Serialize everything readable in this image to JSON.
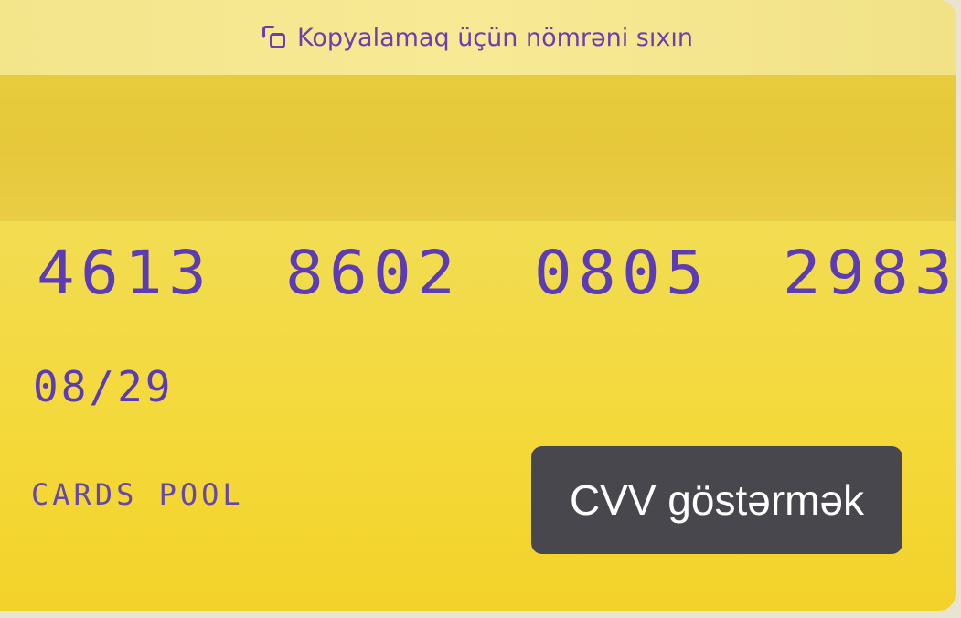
{
  "copy_hint": {
    "icon": "copy-icon",
    "text": "Kopyalamaq üçün nömrəni sıxın",
    "color": "#6b3fb0"
  },
  "card": {
    "number_groups": [
      "4613",
      "8602",
      "0805",
      "2983"
    ],
    "expiry": "08/29",
    "brand": "CARDS POOL",
    "background_color": "#f3d93f",
    "digits_color": "#5b3bb6"
  },
  "cvv_button": {
    "label": "CVV göstərmək",
    "background_color": "#47474d"
  }
}
